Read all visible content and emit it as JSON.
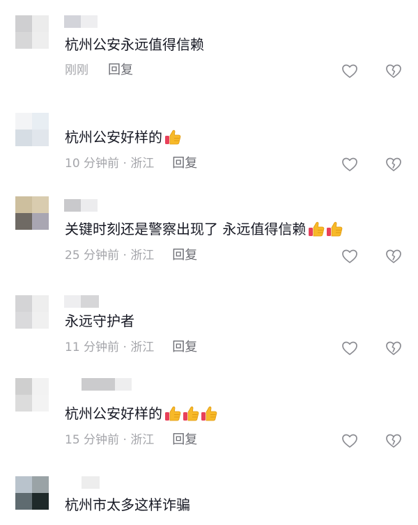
{
  "comments": [
    {
      "text": "杭州公安永远值得信赖",
      "emojis": [],
      "time": "刚刚",
      "location": "",
      "reply_label": "回复",
      "avatar_colors": [
        "#cfcfd1",
        "#ececec",
        "#d7d7d8",
        "#eeeeee"
      ],
      "username_colors": [
        "#d3d4da",
        "#eeeef0"
      ]
    },
    {
      "text": "杭州公安好样的",
      "emojis": [
        "thumbs-up-emoji"
      ],
      "time": "10 分钟前",
      "location": "浙江",
      "reply_label": "回复",
      "avatar_colors": [
        "#f3f4f6",
        "#e8eef3",
        "#d6dde4",
        "#e1e6ec"
      ],
      "username_colors": [
        "#ffffff",
        "#ffffff"
      ]
    },
    {
      "text": "关键时刻还是警察出现了 永远值得信赖",
      "emojis": [
        "thumbs-up-emoji",
        "thumbs-up-emoji"
      ],
      "time": "25 分钟前",
      "location": "浙江",
      "reply_label": "回复",
      "avatar_colors": [
        "#cdbf9e",
        "#d9ccaf",
        "#6f6a64",
        "#a9a6b2"
      ],
      "username_colors": [
        "#c9c9cc",
        "#ececee"
      ]
    },
    {
      "text": "永远守护者",
      "emojis": [],
      "time": "11 分钟前",
      "location": "浙江",
      "reply_label": "回复",
      "avatar_colors": [
        "#d4d4d6",
        "#eeeeee",
        "#dadadc",
        "#f0f0f0"
      ],
      "username_colors": [
        "#eeeef0",
        "#d6d6d8"
      ]
    },
    {
      "text": "杭州公安好样的",
      "emojis": [
        "thumbs-up-emoji",
        "thumbs-up-emoji",
        "thumbs-up-emoji"
      ],
      "time": "15 分钟前",
      "location": "浙江",
      "reply_label": "回复",
      "avatar_colors": [
        "#cfcfcf",
        "#f2f2f2",
        "#dcdcdc",
        "#f3f3f3"
      ],
      "username_colors": [
        "#cbcbcd",
        "#eeeeef"
      ]
    },
    {
      "text": "杭州市太多这样诈骗",
      "emojis": [],
      "time": "",
      "location": "",
      "reply_label": "",
      "avatar_colors": [
        "#b9c3cc",
        "#9aa3a6",
        "#5f6b70",
        "#1f2a2a"
      ],
      "username_colors": [
        "#ededed",
        "#cfcfd1"
      ]
    }
  ],
  "icons": {
    "like": "heart-outline-icon",
    "dislike": "broken-heart-outline-icon"
  },
  "colors": {
    "text_primary": "#161823",
    "text_meta": "#a4a5aa",
    "reply": "#6b6c73",
    "icon": "#8a8b91"
  }
}
